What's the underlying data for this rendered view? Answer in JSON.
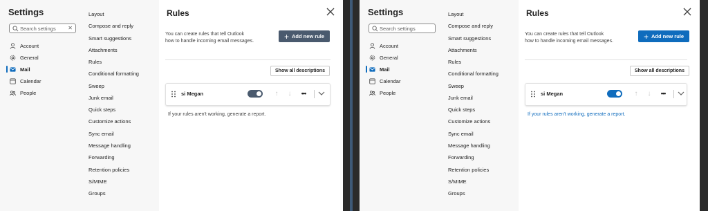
{
  "colors": {
    "accent_blue": "#0f6cbd",
    "add_button_left": "#4a5a6e",
    "toggle_left": "#4a5a6e",
    "report_left": "#424242",
    "report_right": "#0f6cbd"
  },
  "settings": {
    "title": "Settings",
    "search_placeholder": "Search settings",
    "nav": [
      {
        "label": "Account",
        "icon": "person-icon"
      },
      {
        "label": "General",
        "icon": "gear-icon"
      },
      {
        "label": "Mail",
        "icon": "mail-icon"
      },
      {
        "label": "Calendar",
        "icon": "calendar-icon"
      },
      {
        "label": "People",
        "icon": "people-icon"
      }
    ],
    "active_nav": "Mail",
    "mail_submenu": [
      "Layout",
      "Compose and reply",
      "Smart suggestions",
      "Attachments",
      "Rules",
      "Conditional formatting",
      "Sweep",
      "Junk email",
      "Quick steps",
      "Customize actions",
      "Sync email",
      "Message handling",
      "Forwarding",
      "Retention policies",
      "S/MIME",
      "Groups"
    ]
  },
  "rules": {
    "title": "Rules",
    "description_line1": "You can create rules that tell Outlook",
    "description_line2": "how to handle incoming email messages.",
    "add_new_rule": "Add new rule",
    "show_all": "Show all descriptions",
    "rule_name": "si Megan",
    "rule_enabled": true,
    "more_label": "•••",
    "report_text": "If your rules aren't working, generate a report."
  }
}
